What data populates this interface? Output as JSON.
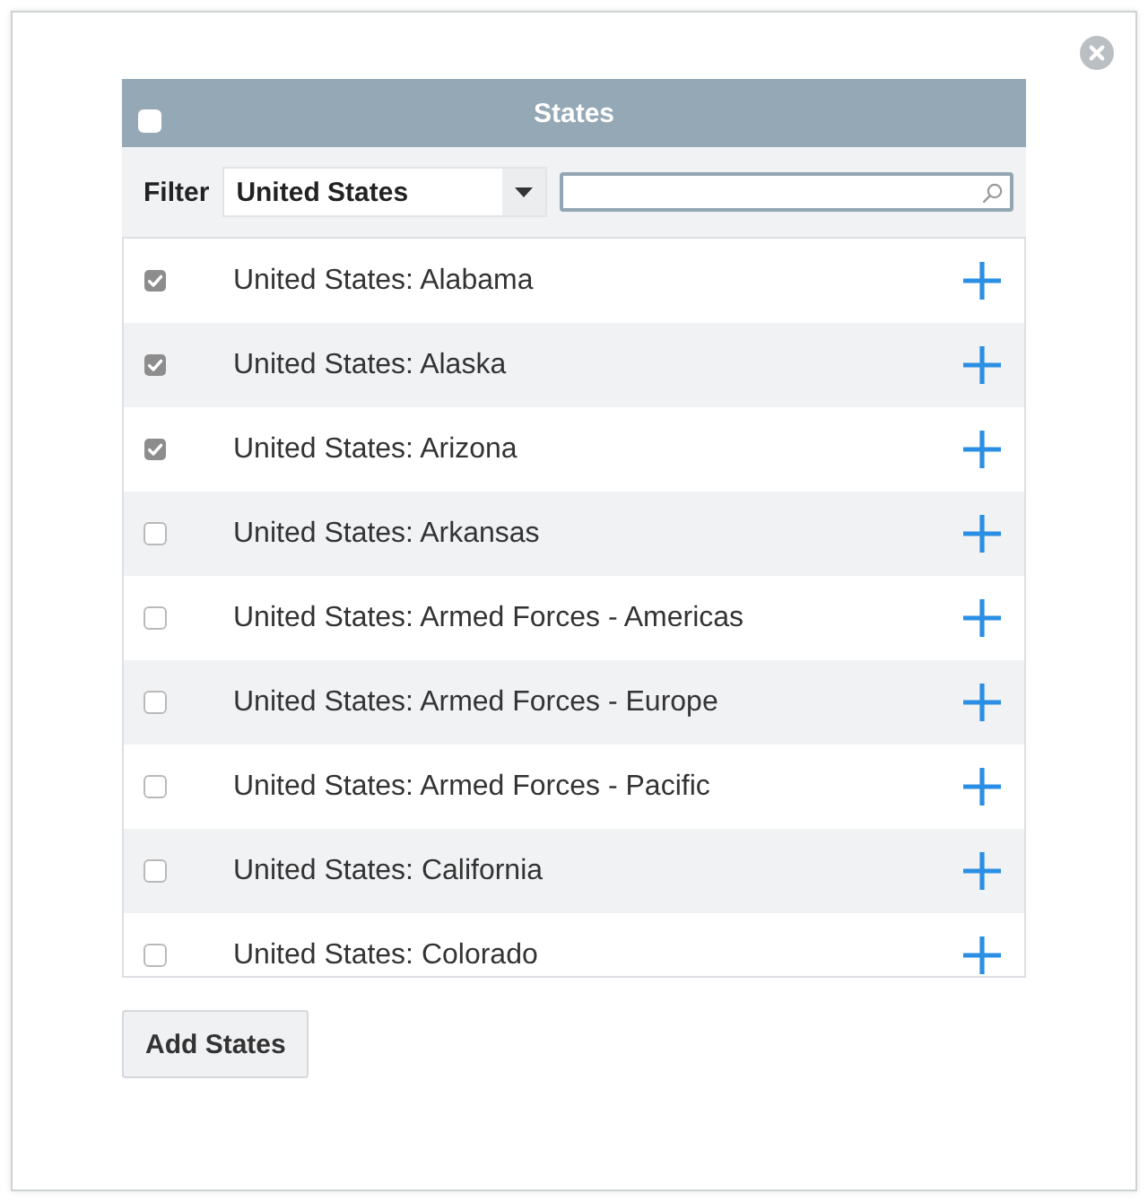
{
  "panel": {
    "title": "States",
    "select_all": {
      "checked": false
    },
    "filter": {
      "label": "Filter",
      "value": "United States"
    },
    "rows": [
      {
        "label": "United States: Alabama",
        "checked": true
      },
      {
        "label": "United States: Alaska",
        "checked": true
      },
      {
        "label": "United States: Arizona",
        "checked": true
      },
      {
        "label": "United States: Arkansas",
        "checked": false
      },
      {
        "label": "United States: Armed Forces - Americas",
        "checked": false
      },
      {
        "label": "United States: Armed Forces - Europe",
        "checked": false
      },
      {
        "label": "United States: Armed Forces - Pacific",
        "checked": false
      },
      {
        "label": "United States: California",
        "checked": false
      },
      {
        "label": "United States: Colorado",
        "checked": false
      }
    ]
  },
  "buttons": [
    "Add States"
  ]
}
